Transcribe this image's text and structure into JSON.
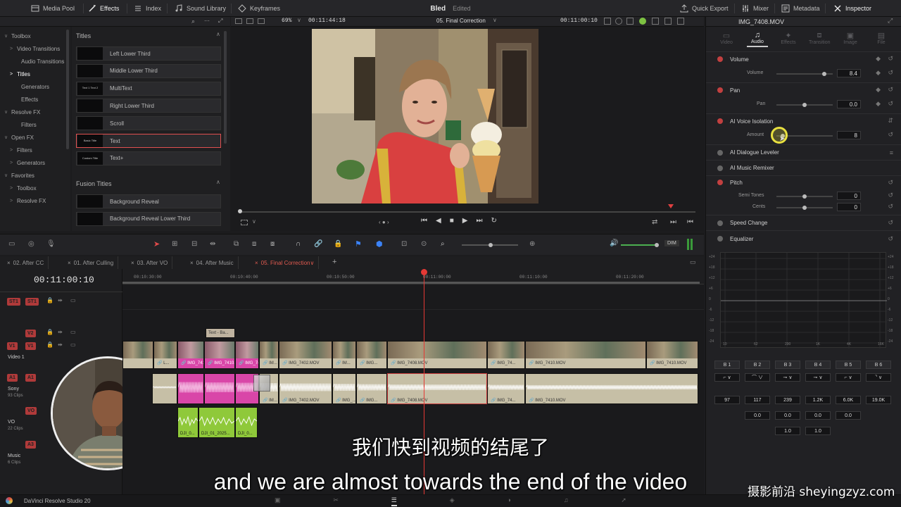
{
  "topbar": {
    "media_pool": "Media Pool",
    "effects": "Effects",
    "index": "Index",
    "sound_library": "Sound Library",
    "keyframes": "Keyframes",
    "project_name": "Bled",
    "project_status": "Edited",
    "quick_export": "Quick Export",
    "mixer": "Mixer",
    "metadata": "Metadata",
    "inspector": "Inspector"
  },
  "effects_tree": [
    {
      "label": "Toolbox",
      "chev": "∨"
    },
    {
      "label": "Video Transitions",
      "chev": ">"
    },
    {
      "label": "Audio Transitions",
      "chev": ""
    },
    {
      "label": "Titles",
      "chev": ">",
      "selected": true
    },
    {
      "label": "Generators",
      "chev": ""
    },
    {
      "label": "Effects",
      "chev": ""
    },
    {
      "label": "Resolve FX",
      "chev": "∨"
    },
    {
      "label": "Filters",
      "chev": ""
    },
    {
      "label": "Open FX",
      "chev": "∨"
    },
    {
      "label": "Filters",
      "chev": ">"
    },
    {
      "label": "Generators",
      "chev": ">"
    },
    {
      "label": "Favorites",
      "chev": "∨"
    },
    {
      "label": "Toolbox",
      "chev": ">"
    },
    {
      "label": "Resolve FX",
      "chev": ">"
    }
  ],
  "titles_panel": {
    "header": "Titles",
    "items": [
      {
        "label": "Left Lower Third",
        "thumb": ""
      },
      {
        "label": "Middle Lower Third",
        "thumb": ""
      },
      {
        "label": "MultiText",
        "thumb": "Text 1 Text 2"
      },
      {
        "label": "Right Lower Third",
        "thumb": ""
      },
      {
        "label": "Scroll",
        "thumb": ""
      },
      {
        "label": "Text",
        "thumb": "Basic Title",
        "selected": true
      },
      {
        "label": "Text+",
        "thumb": "Custom Title"
      }
    ],
    "fusion_header": "Fusion Titles",
    "fusion_items": [
      {
        "label": "Background Reveal"
      },
      {
        "label": "Background Reveal Lower Third"
      }
    ]
  },
  "viewer": {
    "zoom": "69%",
    "source_tc": "00:11:44:18",
    "timeline_name": "05. Final Correction",
    "record_tc": "00:11:00:10"
  },
  "inspector": {
    "clip_name": "IMG_7408.MOV",
    "tabs": [
      "Video",
      "Audio",
      "Effects",
      "Transition",
      "Image",
      "File"
    ],
    "active_tab": "Audio",
    "volume": {
      "title": "Volume",
      "param": "Volume",
      "value": "8.4",
      "level": 0.85
    },
    "pan": {
      "title": "Pan",
      "param": "Pan",
      "value": "0.0",
      "level": 0.5
    },
    "voice_iso": {
      "title": "AI Voice Isolation",
      "param": "Amount",
      "value": "8",
      "level": 0.08
    },
    "dialogue_leveler": "AI Dialogue Leveler",
    "music_remixer": "AI Music Remixer",
    "pitch": {
      "title": "Pitch",
      "semi": "Semi Tones",
      "semi_value": "0",
      "cents": "Cents",
      "cents_value": "0"
    },
    "speed_change": "Speed Change",
    "equalizer": "Equalizer",
    "eq_y_ticks": [
      "+24",
      "+18",
      "+12",
      "+6",
      "0",
      "-6",
      "-12",
      "-18",
      "-24"
    ],
    "eq_x_ticks": [
      "10",
      "62",
      "290",
      "1K",
      "4K",
      "16K"
    ],
    "bands": [
      "B 1",
      "B 2",
      "B 3",
      "B 4",
      "B 5",
      "B 6"
    ],
    "band_freq": [
      "97",
      "117",
      "239",
      "1.2K",
      "6.0K",
      "19.0K"
    ],
    "band_gain": [
      "",
      "0.0",
      "0.0",
      "0.0",
      "0.0",
      ""
    ],
    "band_q": [
      "",
      "",
      "1.0",
      "1.0",
      "",
      ""
    ]
  },
  "timeline": {
    "tabs": [
      "02. After CC",
      "01. After Culling",
      "03. After VO",
      "04. After Music",
      "05. Final Correction"
    ],
    "active_tab": "05. Final Correction",
    "timecode": "00:11:00:10",
    "ruler": [
      "00:10:30:00",
      "00:10:40:00",
      "00:10:50:00",
      "00:11:00:00",
      "00:11:10:00",
      "00:11:20:00"
    ],
    "dim_label": "DIM",
    "tracks": {
      "st1": "ST1",
      "v2": "V2",
      "v1": "V1",
      "v1_name": "Video 1",
      "a1": "A1",
      "a1_name": "Sony",
      "a1_clips": "93 Clips",
      "vo": "VO",
      "vo_name": "VO",
      "vo_clips": "22 Clips",
      "a3": "A3",
      "music_name": "Music",
      "music_clips": "6 Clips"
    },
    "title_clip": "Text - Ba...",
    "video_clips": [
      "IMG_7402.MOV",
      "IMG_7408.MOV",
      "IMG_74...",
      "IMG_7410.MOV",
      "IMG_7410.MOV",
      "IM...",
      "IMG...",
      "IMG_...",
      "L..."
    ],
    "audio_clips": [
      "IMG_7402.MOV",
      "IMG_7408.MOV",
      "IMG_74...",
      "IMG_7410.MOV",
      "IM...",
      "IMG...",
      "IMG_..."
    ],
    "vo_clips": [
      "DJI_0...",
      "DJI_01_2025...",
      "DJI_0..."
    ]
  },
  "subtitles": {
    "cn": "我们快到视频的结尾了",
    "en": "and we are almost towards the end of the video"
  },
  "watermark": "摄影前沿 sheyingzyz.com",
  "status": {
    "app": "DaVinci Resolve Studio 20"
  }
}
